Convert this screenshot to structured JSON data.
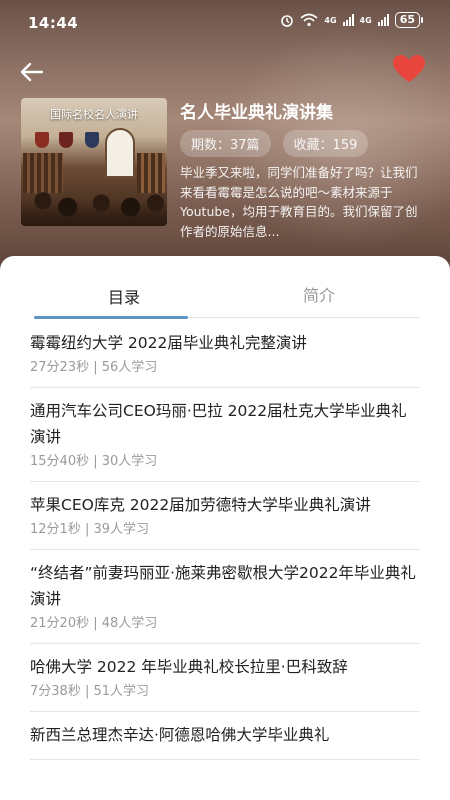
{
  "status_bar": {
    "time": "14:44",
    "net_badge": "4G",
    "net_badge2": "4G",
    "battery": "65"
  },
  "header": {
    "back_icon": "back-arrow-icon",
    "favorite_icon": "heart-icon",
    "favorite_color": "#e8463c"
  },
  "course": {
    "cover_title": "国际名校名人演讲",
    "title": "名人毕业典礼演讲集",
    "episodes": "期数：37篇",
    "favorites": "收藏：159",
    "description": "毕业季又来啦，同学们准备好了吗？让我们来看看霉霉是怎么说的吧～素材来源于 Youtube，均用于教育目的。我们保留了创作者的原始信息..."
  },
  "tabs": {
    "catalog": "目录",
    "intro": "简介",
    "active_color": "#5a93c4"
  },
  "items": [
    {
      "title": "霉霉纽约大学 2022届毕业典礼完整演讲",
      "meta": "27分23秒 | 56人学习"
    },
    {
      "title": "通用汽车公司CEO玛丽·巴拉 2022届杜克大学毕业典礼演讲",
      "meta": "15分40秒 | 30人学习"
    },
    {
      "title": "苹果CEO库克 2022届加劳德特大学毕业典礼演讲",
      "meta": "12分1秒 | 39人学习"
    },
    {
      "title": "“终结者”前妻玛丽亚·施莱弗密歇根大学2022年毕业典礼演讲",
      "meta": "21分20秒 | 48人学习"
    },
    {
      "title": "哈佛大学 2022 年毕业典礼校长拉里·巴科致辞",
      "meta": "7分38秒 | 51人学习"
    },
    {
      "title": "新西兰总理杰辛达·阿德恩哈佛大学毕业典礼",
      "meta": ""
    }
  ]
}
